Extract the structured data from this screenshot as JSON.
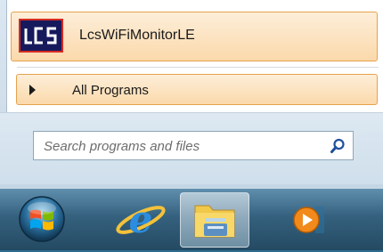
{
  "start_menu": {
    "pinned_program": {
      "label": "LcsWiFiMonitorLE",
      "icon": "lcs-logo-icon",
      "icon_text": "LCS"
    },
    "all_programs": {
      "label": "All Programs",
      "icon": "arrow-right-icon"
    },
    "search": {
      "placeholder": "Search programs and files",
      "value": "",
      "icon": "search-icon"
    }
  },
  "taskbar": {
    "start_button": {
      "icon": "windows-orb-icon"
    },
    "pinned": [
      {
        "icon": "internet-explorer-icon",
        "active": false
      },
      {
        "icon": "windows-explorer-icon",
        "active": true
      },
      {
        "icon": "media-player-icon",
        "active": false
      }
    ]
  },
  "colors": {
    "highlight": "#fbd9ab",
    "highlight_border": "#e5a24d",
    "taskbar": "#35617e"
  }
}
